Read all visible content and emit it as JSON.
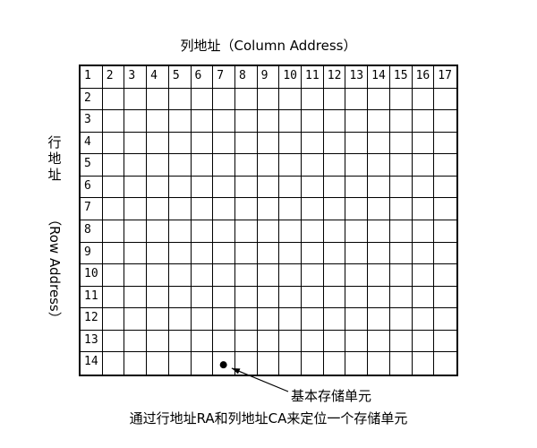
{
  "column_axis": {
    "title": "列地址（Column Address）"
  },
  "row_axis": {
    "title_cjk": "行地址",
    "title_en": "（Row Address）"
  },
  "grid": {
    "columns": 17,
    "rows": 14,
    "column_numbers": [
      "1",
      "2",
      "3",
      "4",
      "5",
      "6",
      "7",
      "8",
      "9",
      "10",
      "11",
      "12",
      "13",
      "14",
      "15",
      "16",
      "17"
    ],
    "row_numbers": [
      "2",
      "3",
      "4",
      "5",
      "6",
      "7",
      "8",
      "9",
      "10",
      "11",
      "12",
      "13",
      "14"
    ],
    "marked_cell": {
      "row": 14,
      "column": 7
    }
  },
  "callout": {
    "label": "基本存储单元"
  },
  "caption": "通过行地址RA和列地址CA来定位一个存储单元",
  "colors": {
    "line": "#000000",
    "background": "#ffffff"
  }
}
